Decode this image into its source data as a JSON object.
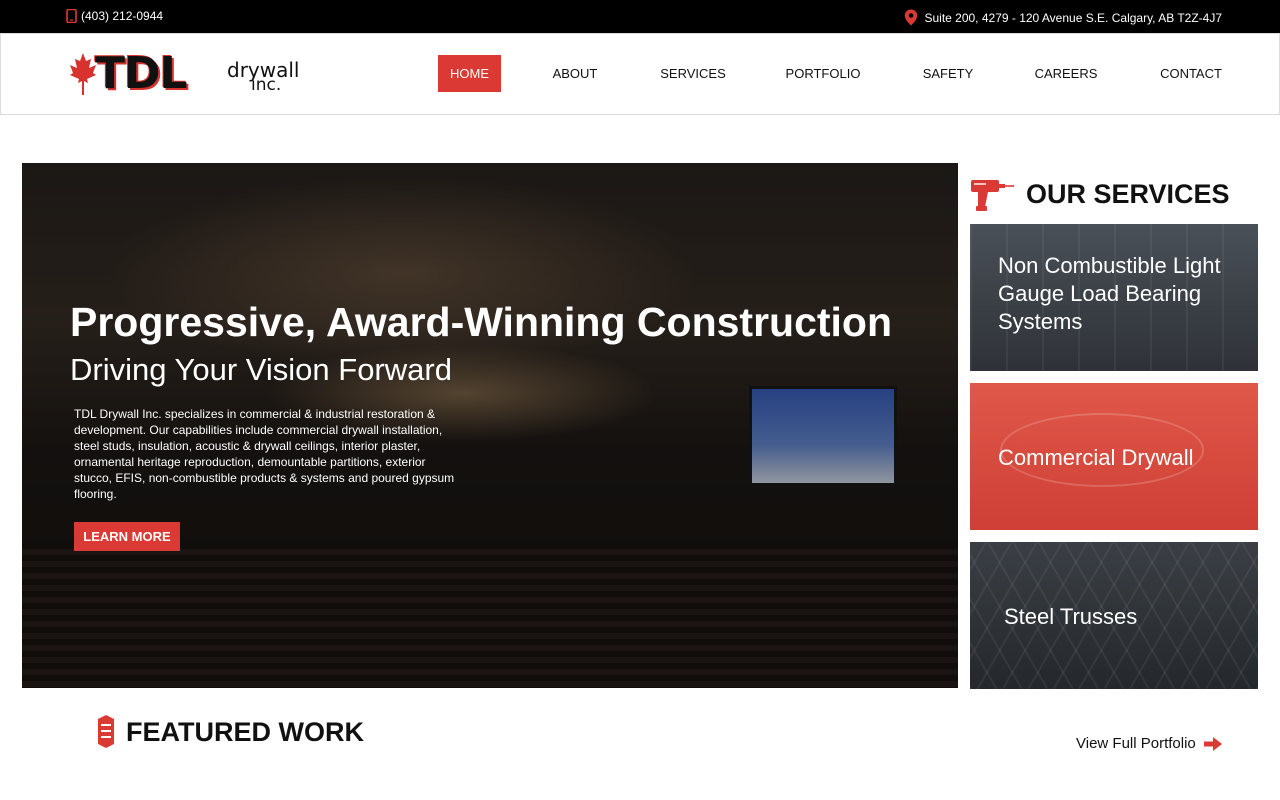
{
  "topbar": {
    "phone": "(403) 212-0944",
    "address": "Suite 200, 4279 - 120 Avenue S.E. Calgary, AB T2Z-4J7"
  },
  "logo": {
    "main": "TDL",
    "line1": "drywall",
    "line2": "inc."
  },
  "nav": [
    {
      "label": "HOME",
      "active": true
    },
    {
      "label": "ABOUT",
      "active": false
    },
    {
      "label": "SERVICES",
      "active": false
    },
    {
      "label": "PORTFOLIO",
      "active": false
    },
    {
      "label": "SAFETY",
      "active": false
    },
    {
      "label": "CAREERS",
      "active": false
    },
    {
      "label": "CONTACT",
      "active": false
    }
  ],
  "hero": {
    "title": "Progressive, Award-Winning Construction",
    "subtitle": "Driving Your Vision Forward",
    "description": "TDL Drywall Inc. specializes in commercial & industrial restoration & development. Our capabilities include commercial drywall installation, steel studs, insulation, acoustic & drywall ceilings, interior plaster, ornamental heritage reproduction, demountable partitions, exterior stucco, EFIS, non-combustible products & systems and poured gypsum flooring.",
    "button": "LEARN MORE"
  },
  "services": {
    "title": "OUR SERVICES",
    "items": [
      "Non Combustible Light Gauge Load Bearing Systems",
      "Commercial Drywall",
      "Steel Trusses"
    ]
  },
  "featured": {
    "title": "FEATURED WORK",
    "link": "View Full Portfolio"
  },
  "colors": {
    "accent": "#db3a34",
    "topbar": "#000000"
  }
}
